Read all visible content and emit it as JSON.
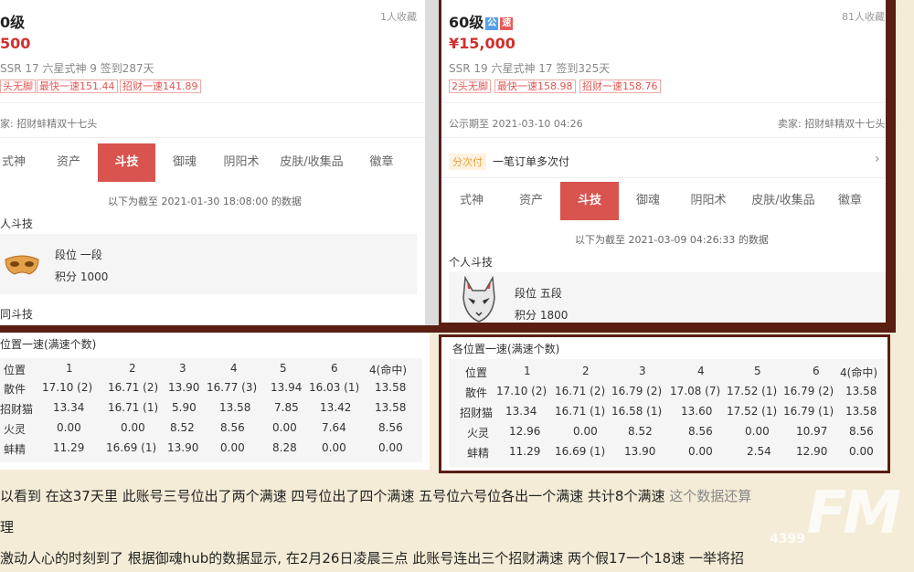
{
  "left": {
    "level": "0级",
    "favorites": "1人收藏",
    "price": "500",
    "stats": "SSR 17  六星式神 9  签到287天",
    "tags": [
      "头无脚",
      "最快一速151.44",
      "招财一速141.89"
    ],
    "seller": "家: 招财蚌精双十七头",
    "tabs": [
      "式神",
      "资产",
      "斗技",
      "御魂",
      "阴阳术",
      "皮肤/收集品",
      "徽章"
    ],
    "data_note": "以下为截至 2021-01-30 18:08:00 的数据",
    "section_individual": "人斗技",
    "rank_label": "段位  一段",
    "points_label": "积分  1000",
    "section_team": "同斗技"
  },
  "right": {
    "level": "60级",
    "badge_public": "公",
    "badge_fast": "速",
    "favorites": "81人收藏",
    "price": "¥15,000",
    "stats": "SSR 19  六星式神 17  签到325天",
    "tags": [
      "2头无脚",
      "最快一速158.98",
      "招财一速158.76"
    ],
    "public_period": "公示期至 2021-03-10 04:26",
    "seller": "卖家: 招财蚌精双十七头",
    "installment_pill": "分次付",
    "installment_text": "一笔订单多次付",
    "tabs": [
      "式神",
      "资产",
      "斗技",
      "御魂",
      "阴阳术",
      "皮肤/收集品",
      "徽章"
    ],
    "data_note": "以下为截至 2021-03-09 04:26:33 的数据",
    "section_individual": "个人斗技",
    "rank_label": "段位  五段",
    "points_label": "积分  1800"
  },
  "table_left": {
    "title": "位置一速(满速个数)",
    "header": [
      "位置",
      "1",
      "2",
      "3",
      "4",
      "5",
      "6",
      "4(命中)"
    ],
    "rows": [
      [
        "散件",
        "17.10 (2)",
        "16.71 (2)",
        "13.90",
        "16.77 (3)",
        "13.94",
        "16.03 (1)",
        "13.58"
      ],
      [
        "招财猫",
        "13.34",
        "16.71 (1)",
        "5.90",
        "13.58",
        "7.85",
        "13.42",
        "13.58"
      ],
      [
        "火灵",
        "0.00",
        "0.00",
        "8.52",
        "8.56",
        "0.00",
        "7.64",
        "8.56"
      ],
      [
        "蚌精",
        "11.29",
        "16.69 (1)",
        "13.90",
        "0.00",
        "8.28",
        "0.00",
        "0.00"
      ]
    ]
  },
  "table_right": {
    "title": "各位置一速(满速个数)",
    "header": [
      "位置",
      "1",
      "2",
      "3",
      "4",
      "5",
      "6",
      "4(命中)"
    ],
    "rows": [
      [
        "散件",
        "17.10 (2)",
        "16.71 (2)",
        "16.79 (2)",
        "17.08 (7)",
        "17.52 (1)",
        "16.79 (2)",
        "13.58"
      ],
      [
        "招财猫",
        "13.34",
        "16.71 (1)",
        "16.58 (1)",
        "13.60",
        "17.52 (1)",
        "16.79 (1)",
        "13.58"
      ],
      [
        "火灵",
        "12.96",
        "0.00",
        "8.52",
        "8.56",
        "0.00",
        "10.97",
        "8.56"
      ],
      [
        "蚌精",
        "11.29",
        "16.69 (1)",
        "13.90",
        "0.00",
        "2.54",
        "12.90",
        "0.00"
      ]
    ]
  },
  "article": {
    "line1_main": "以看到 在这37天里 此账号三号位出了两个满速 四号位出了四个满速 五号位六号位各出一个满速 共计8个满速 ",
    "line1_faint": "这个数据还算",
    "line2": "理",
    "line3": "激动人心的时刻到了 根据御魂hub的数据显示, 在2月26日凌晨三点 此账号连出三个招财满速 两个假17一个18速 一举将招"
  },
  "watermark": {
    "logo": "FM",
    "number": "4399"
  }
}
